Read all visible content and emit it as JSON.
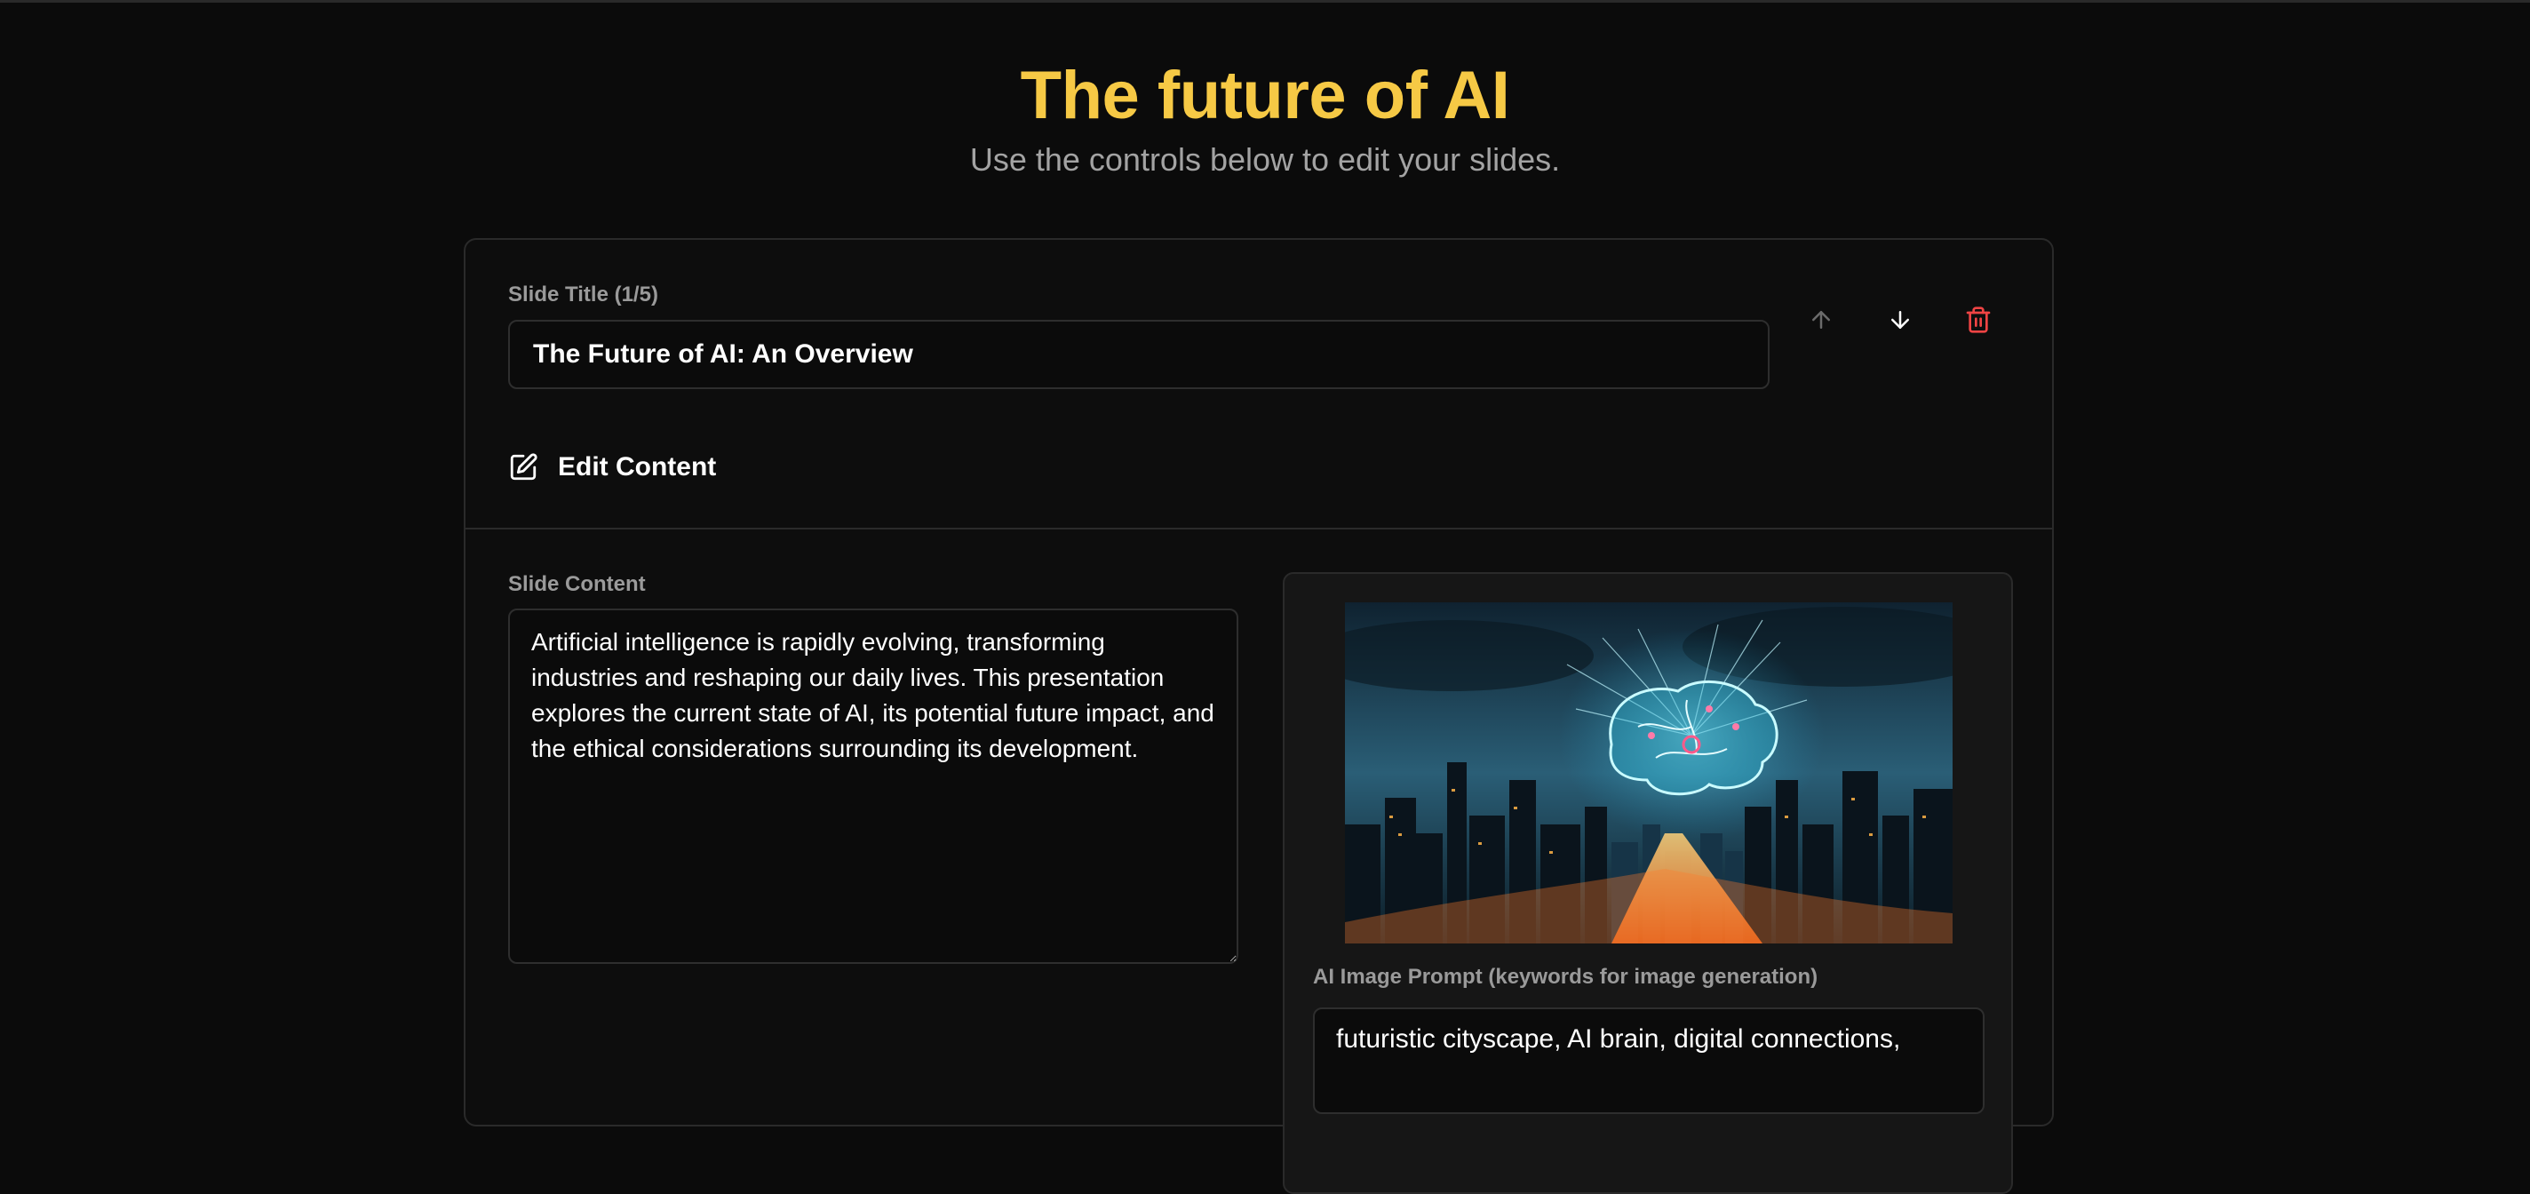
{
  "header": {
    "title": "The future of AI",
    "subtitle": "Use the controls below to edit your slides."
  },
  "slide": {
    "title_label": "Slide Title (1/5)",
    "title_value": "The Future of AI: An Overview",
    "edit_content_label": "Edit Content",
    "content_label": "Slide Content",
    "content_value": "Artificial intelligence is rapidly evolving, transforming industries and reshaping our daily lives. This presentation explores the current state of AI, its potential future impact, and the ethical considerations surrounding its development.",
    "image_prompt_label": "AI Image Prompt (keywords for image generation)",
    "image_prompt_value": "futuristic cityscape, AI brain, digital connections,"
  },
  "icons": {
    "move_up": "arrow-up-icon",
    "move_down": "arrow-down-icon",
    "delete": "trash-icon",
    "edit": "edit-icon"
  },
  "colors": {
    "accent": "#f6c945",
    "danger": "#ef4444",
    "background": "#0b0b0b"
  }
}
